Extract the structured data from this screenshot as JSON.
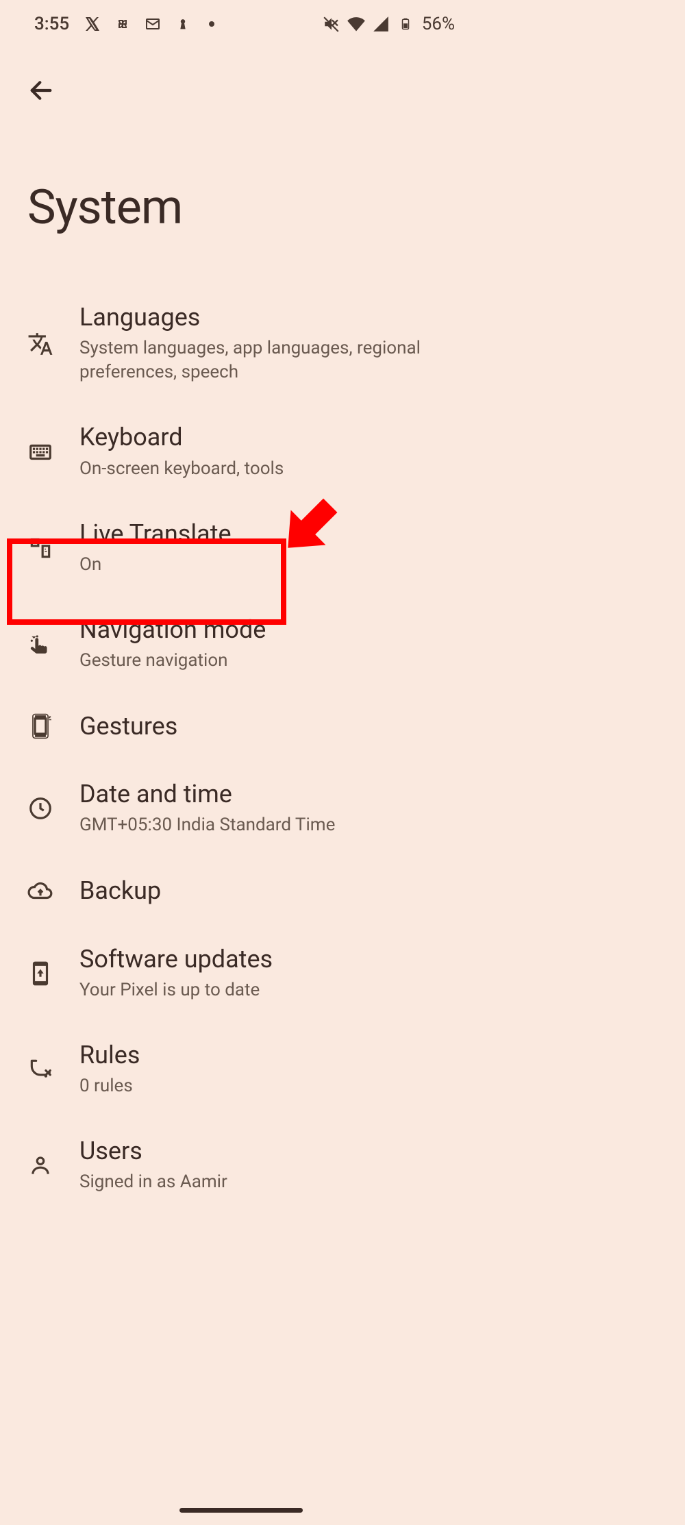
{
  "status_bar": {
    "time": "3:55",
    "battery": "56%"
  },
  "page_title": "System",
  "items": [
    {
      "title": "Languages",
      "sub": "System languages, app languages, regional preferences, speech"
    },
    {
      "title": "Keyboard",
      "sub": "On-screen keyboard, tools"
    },
    {
      "title": "Live Translate",
      "sub": "On"
    },
    {
      "title": "Navigation mode",
      "sub": "Gesture navigation"
    },
    {
      "title": "Gestures",
      "sub": ""
    },
    {
      "title": "Date and time",
      "sub": "GMT+05:30 India Standard Time"
    },
    {
      "title": "Backup",
      "sub": ""
    },
    {
      "title": "Software updates",
      "sub": "Your Pixel is up to date"
    },
    {
      "title": "Rules",
      "sub": "0 rules"
    },
    {
      "title": "Users",
      "sub": "Signed in as Aamir"
    }
  ],
  "annotation": {
    "highlighted_item": "Navigation mode",
    "pointer": "red-arrow"
  }
}
